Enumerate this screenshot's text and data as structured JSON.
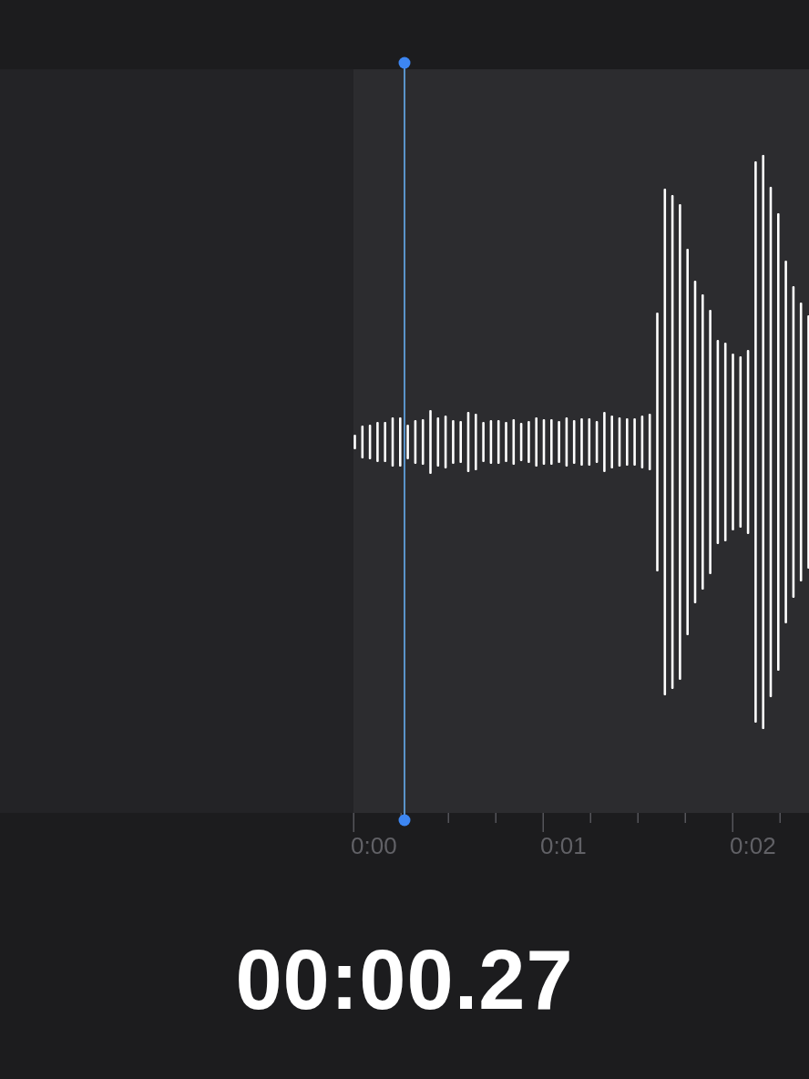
{
  "timeline": {
    "tick_labels": [
      "0:00",
      "0:01",
      "0:02"
    ]
  },
  "time_display": {
    "text": "00:00.27"
  }
}
